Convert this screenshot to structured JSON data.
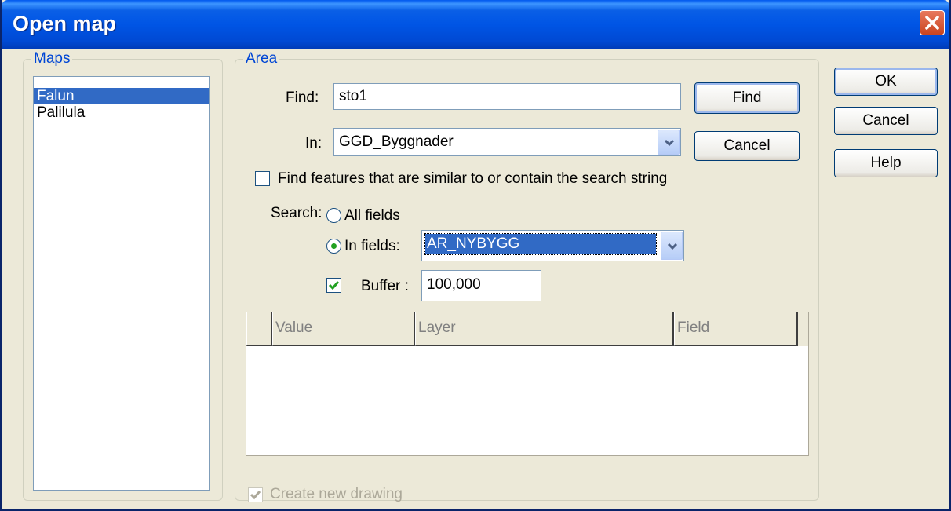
{
  "window": {
    "title": "Open map"
  },
  "maps": {
    "legend": "Maps",
    "items": [
      "Falun",
      "Palilula"
    ],
    "selected_index": 0
  },
  "area": {
    "legend": "Area",
    "find_label": "Find:",
    "find_value": "sto1",
    "in_label": "In:",
    "in_value": "GGD_Byggnader",
    "similar_label": "Find features that are similar to or contain the search string",
    "similar_checked": false,
    "search_label": "Search:",
    "all_fields_label": "All fields",
    "in_fields_label": "In fields:",
    "in_fields_value": "AR_NYBYGG",
    "search_mode": "in_fields",
    "buffer_label": "Buffer :",
    "buffer_value": "100,000",
    "buffer_checked": true,
    "columns": [
      "Value",
      "Layer",
      "Field"
    ],
    "rows": [],
    "create_drawing_label": "Create new drawing",
    "create_drawing_checked": true
  },
  "buttons": {
    "find": "Find",
    "cancel_area": "Cancel",
    "ok": "OK",
    "cancel": "Cancel",
    "help": "Help"
  },
  "colors": {
    "titlebar": "#0055e5",
    "selection": "#316ac5",
    "legend": "#0046d5",
    "dialog_bg": "#ece9d8"
  }
}
